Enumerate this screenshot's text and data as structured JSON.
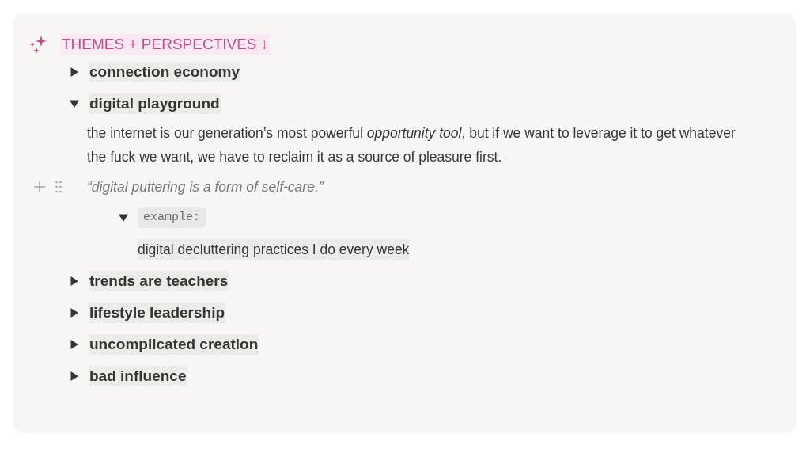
{
  "heading": {
    "text": "THEMES + PERSPECTIVES ↓"
  },
  "toggles": [
    {
      "title": "connection economy",
      "expanded": false
    },
    {
      "title": "digital playground",
      "expanded": true,
      "paragraph": {
        "before": "the internet is our generation’s most powerful ",
        "link": "opportunity tool",
        "after": ", but if we want to leverage it to get whatever the fuck we want, we have to reclaim it as a source of pleasure first."
      },
      "quote": "“digital puttering is a form of self-care.”",
      "subtoggle": {
        "title": "example:",
        "expanded": true,
        "child": "digital decluttering practices I do every week"
      }
    },
    {
      "title": "trends are teachers",
      "expanded": false
    },
    {
      "title": "lifestyle leadership",
      "expanded": false
    },
    {
      "title": "uncomplicated creation",
      "expanded": false
    },
    {
      "title": "bad influence",
      "expanded": false
    }
  ]
}
